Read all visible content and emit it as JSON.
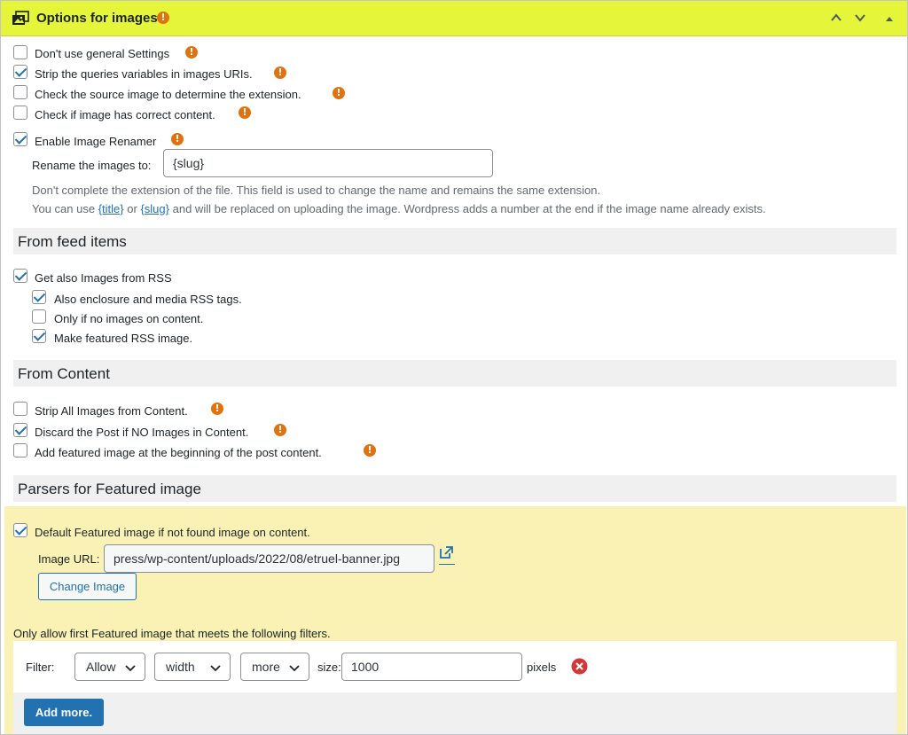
{
  "header": {
    "title": "Options for images",
    "accent": "#e4f53a"
  },
  "general": {
    "dont_use_general": {
      "label": "Don't use general Settings",
      "checked": false
    },
    "strip_queries": {
      "label": "Strip the queries variables in images URIs.",
      "checked": true
    },
    "check_source": {
      "label": "Check the source image to determine the extension.",
      "checked": false
    },
    "check_content": {
      "label": "Check if image has correct content.",
      "checked": false
    },
    "enable_renamer": {
      "label": "Enable Image Renamer",
      "checked": true
    },
    "rename_label": "Rename the images to:",
    "rename_value": "{slug}",
    "desc_line1": "Don't complete the extension of the file. This field is used to change the name and remains the same extension.",
    "desc_use": "You can use",
    "desc_title_link": "{title}",
    "desc_or": "or",
    "desc_slug_link": "{slug}",
    "desc_rest": "and will be replaced on uploading the image. Wordpress adds a number at the end if the image name already exists."
  },
  "feed_items": {
    "heading": "From feed items",
    "get_rss": {
      "label": "Get also Images from RSS",
      "checked": true
    },
    "enclosure": {
      "label": "Also enclosure and media RSS tags.",
      "checked": true
    },
    "only_if_none": {
      "label": "Only if no images on content.",
      "checked": false
    },
    "featured_rss": {
      "label": "Make featured RSS image.",
      "checked": true
    }
  },
  "content": {
    "heading": "From Content",
    "strip_all": {
      "label": "Strip All Images from Content.",
      "checked": false
    },
    "discard_post": {
      "label": "Discard the Post if NO Images in Content.",
      "checked": true
    },
    "add_featured": {
      "label": "Add featured image at the beginning of the post content.",
      "checked": false
    }
  },
  "parsers": {
    "heading": "Parsers for Featured image",
    "default_featured": {
      "label": "Default Featured image if not found image on content.",
      "checked": true
    },
    "image_url_label": "Image URL:",
    "image_url_value": "press/wp-content/uploads/2022/08/etruel-banner.jpg",
    "change_image_label": "Change Image",
    "filters_title": "Only allow first Featured image that meets the following filters.",
    "filter_label": "Filter:",
    "filter_allow": "Allow",
    "filter_dimension": "width",
    "filter_compare": "more",
    "size_label": "size:",
    "size_value": "1000",
    "pixels_label": "pixels",
    "add_more_label": "Add more."
  }
}
